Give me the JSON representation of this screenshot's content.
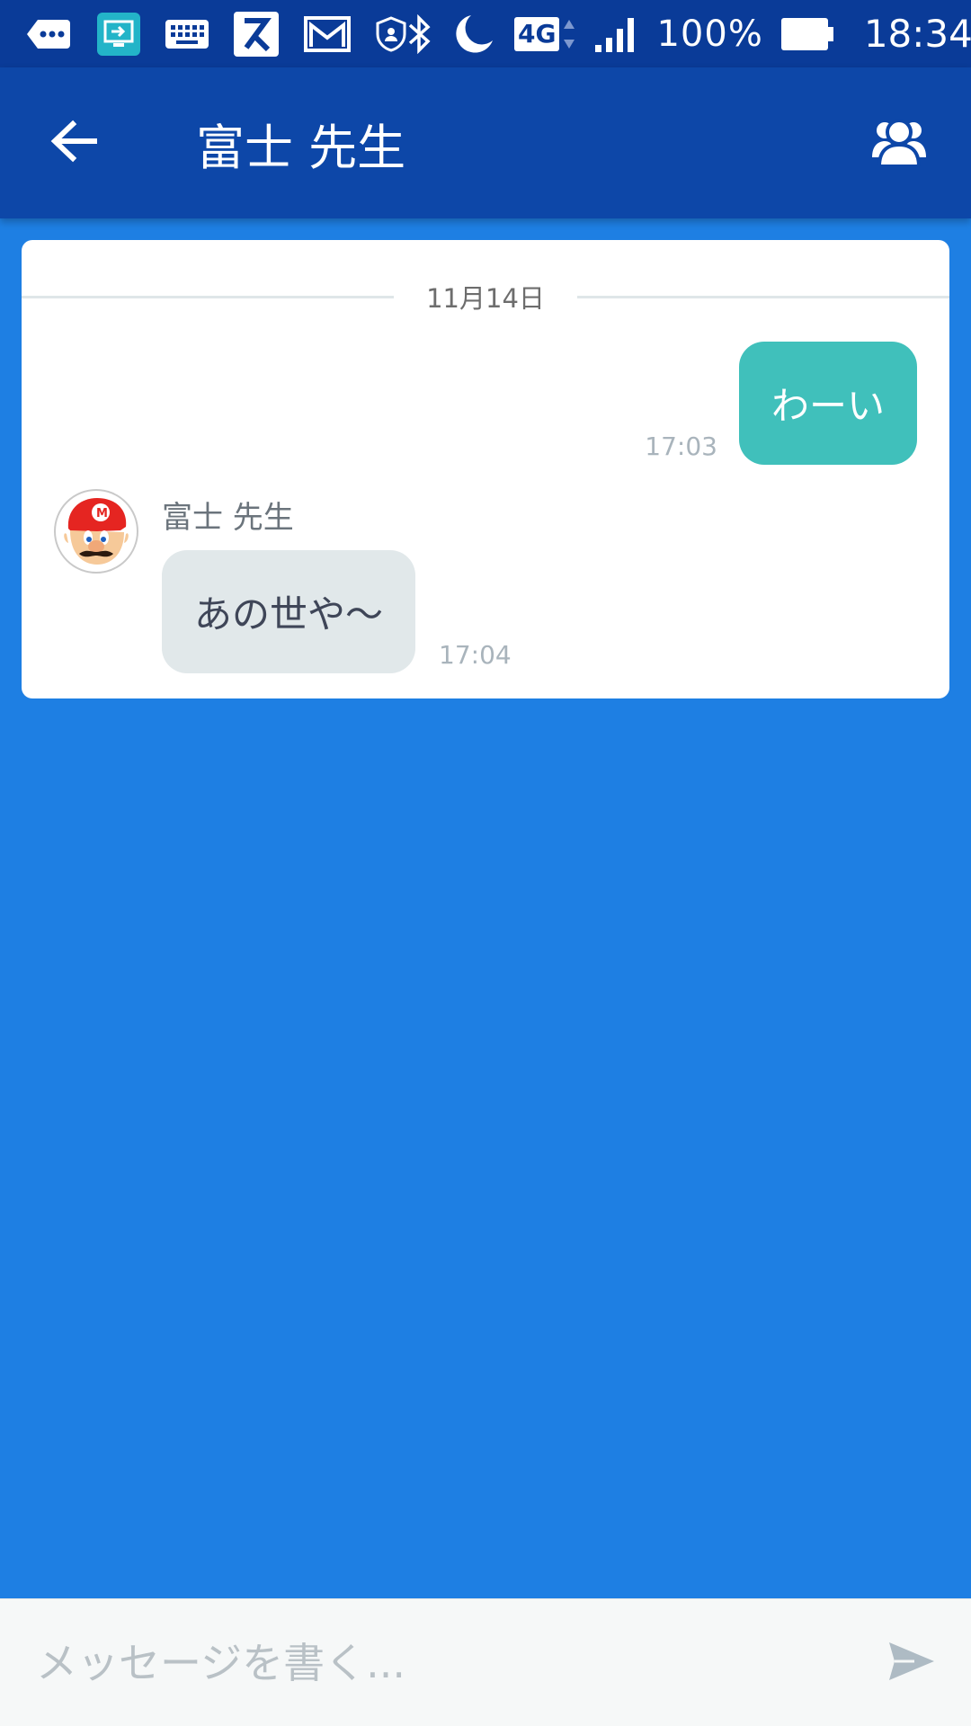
{
  "status_bar": {
    "icons_left": [
      "more-notification-icon",
      "screen-cast-icon",
      "keyboard-icon",
      "app-k-icon",
      "gmail-icon",
      "shield-icon"
    ],
    "icons_right": [
      "bluetooth-icon",
      "do-not-disturb-moon-icon",
      "network-4g-icon",
      "signal-icon",
      "battery-icon"
    ],
    "network": "4G",
    "battery": "100%",
    "time": "18:34"
  },
  "header": {
    "title": "富士 先生"
  },
  "chat": {
    "date": "11月14日",
    "outgoing": {
      "text": "わーい",
      "time": "17:03"
    },
    "incoming": {
      "sender": "富士 先生",
      "text": "あの世や〜",
      "time": "17:04"
    }
  },
  "composer": {
    "placeholder": "メッセージを書く..."
  },
  "colors": {
    "status_bar": "#0a3b98",
    "app_bar": "#0d47a8",
    "background": "#1e7fe3",
    "outgoing_bubble": "#40c0bb",
    "incoming_bubble": "#e1e8ea"
  }
}
